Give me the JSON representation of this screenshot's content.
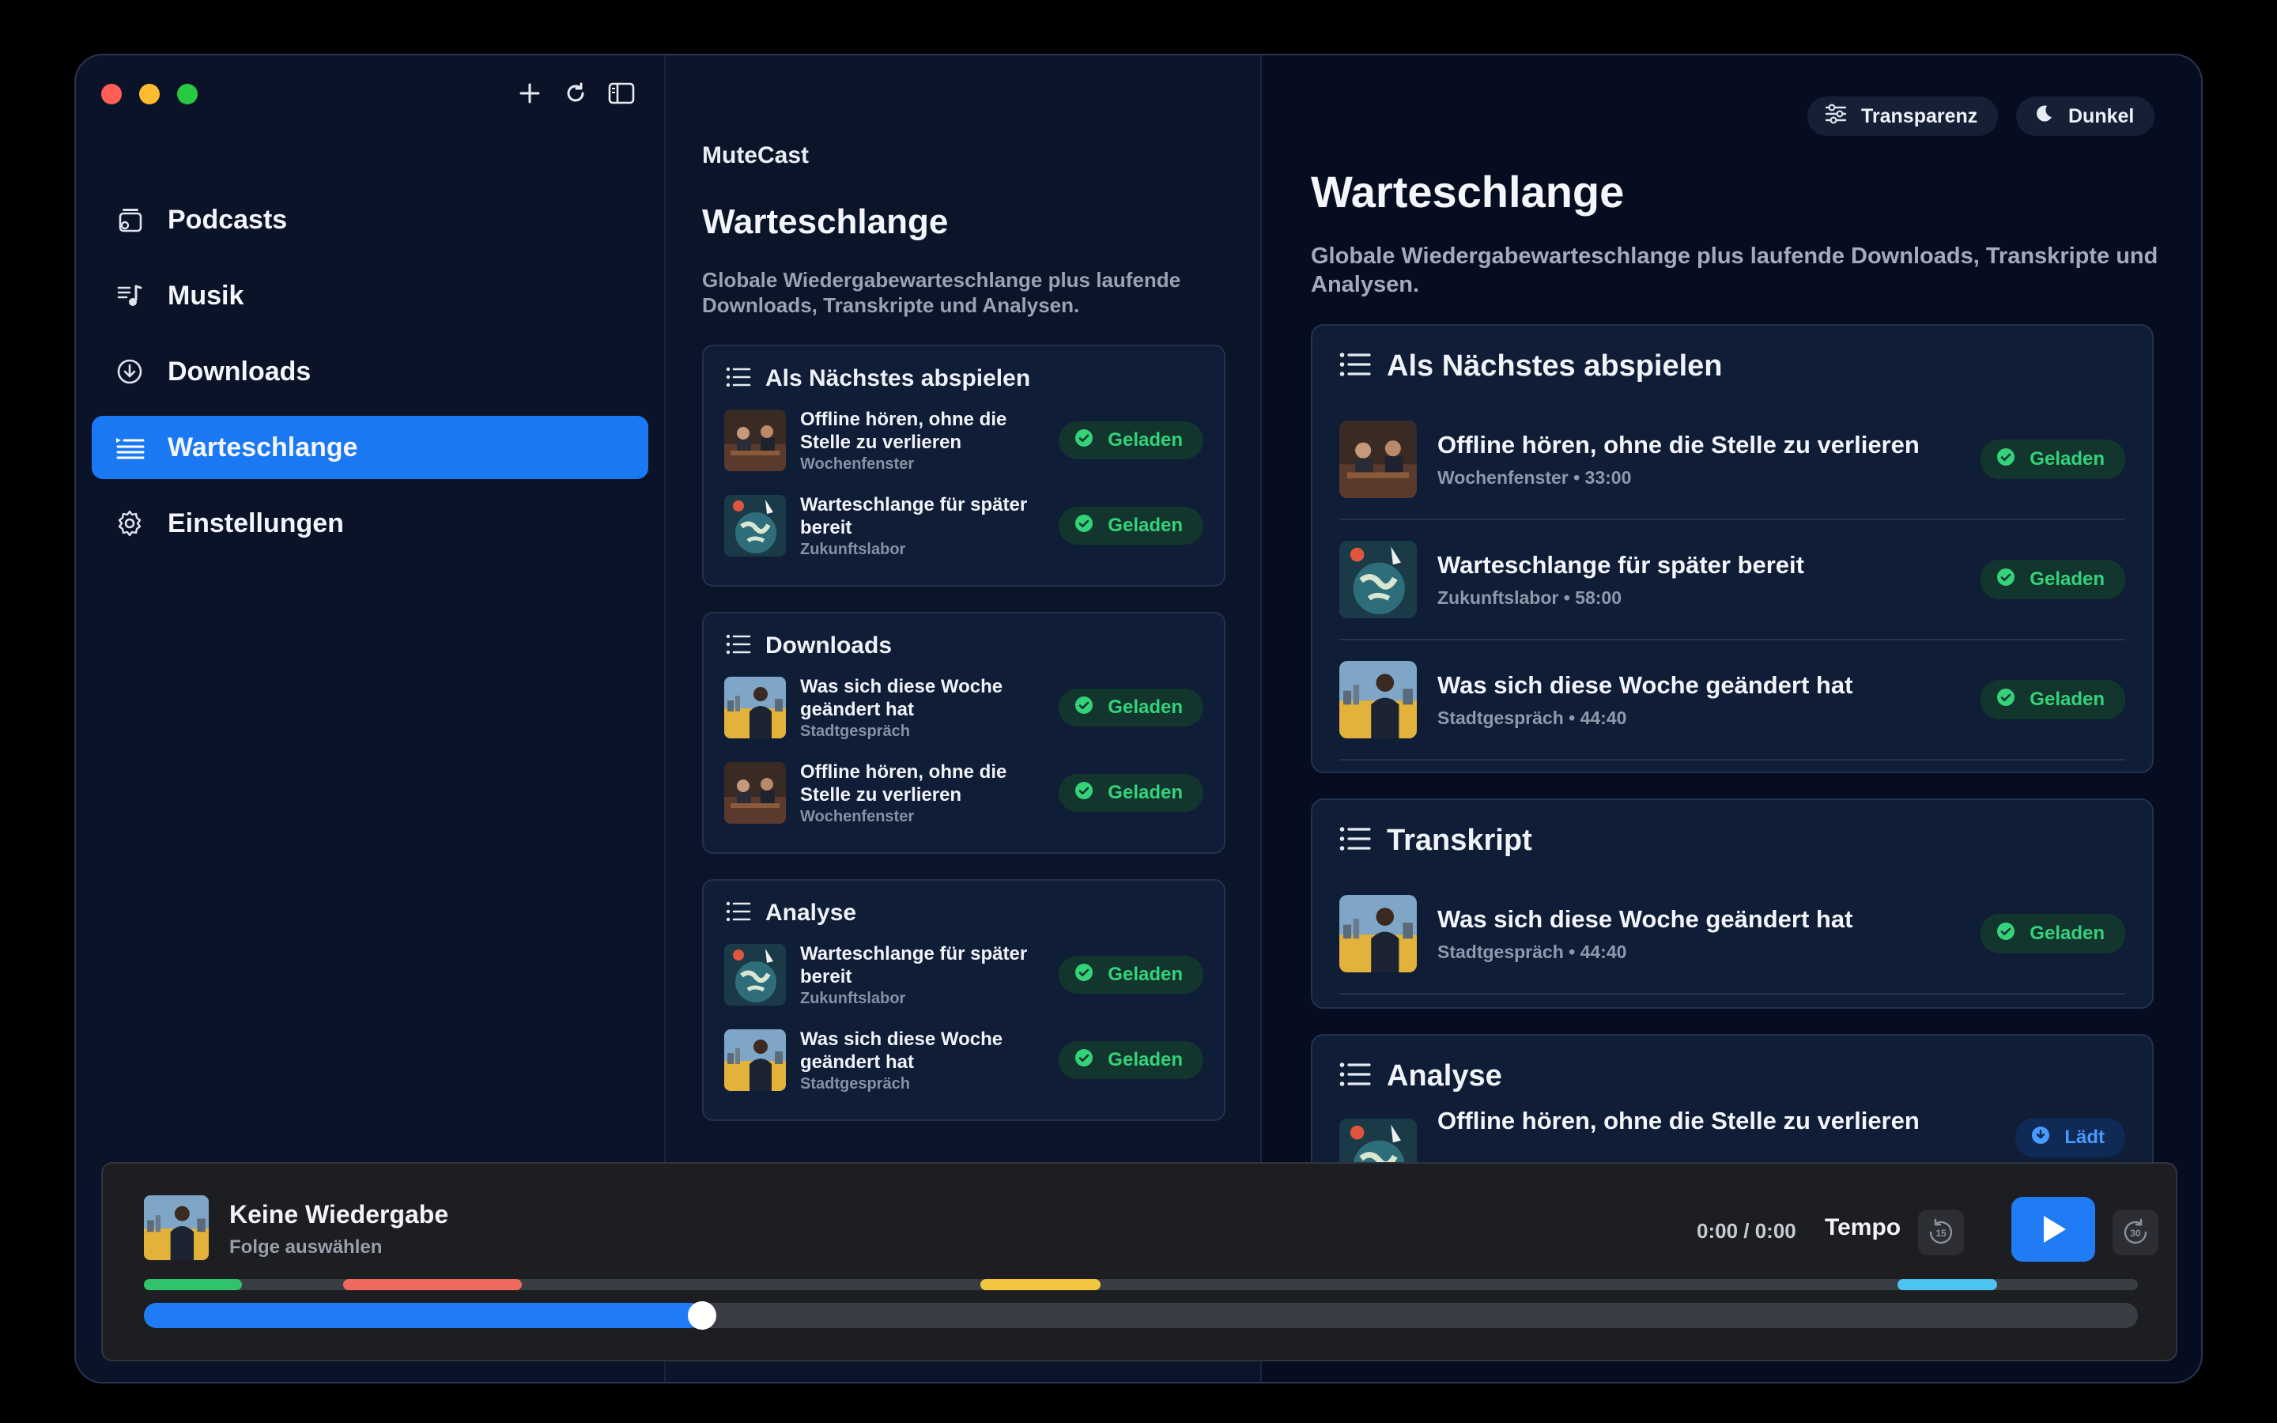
{
  "app": {
    "name": "MuteCast"
  },
  "sidebar": {
    "items": [
      {
        "label": "Podcasts",
        "icon": "podcasts-icon",
        "active": false
      },
      {
        "label": "Musik",
        "icon": "music-icon",
        "active": false
      },
      {
        "label": "Downloads",
        "icon": "download-icon",
        "active": false
      },
      {
        "label": "Warteschlange",
        "icon": "queue-icon",
        "active": true
      },
      {
        "label": "Einstellungen",
        "icon": "gear-icon",
        "active": false
      }
    ]
  },
  "middle": {
    "title": "Warteschlange",
    "subtitle": "Globale Wiedergabewarteschlange plus laufende Downloads, Transkripte und Analysen.",
    "sections": [
      {
        "title": "Als Nächstes abspielen",
        "items": [
          {
            "title": "Offline hören, ohne die Stelle zu verlieren",
            "show": "Wochenfenster",
            "status": "Geladen"
          },
          {
            "title": "Warteschlange für später bereit",
            "show": "Zukunftslabor",
            "status": "Geladen"
          }
        ]
      },
      {
        "title": "Downloads",
        "items": [
          {
            "title": "Was sich diese Woche geändert hat",
            "show": "Stadtgespräch",
            "status": "Geladen"
          },
          {
            "title": "Offline hören, ohne die Stelle zu verlieren",
            "show": "Wochenfenster",
            "status": "Geladen"
          }
        ]
      },
      {
        "title": "Analyse",
        "items": [
          {
            "title": "Warteschlange für später bereit",
            "show": "Zukunftslabor",
            "status": "Geladen"
          },
          {
            "title": "Was sich diese Woche geändert hat",
            "show": "Stadtgespräch",
            "status": "Geladen"
          }
        ]
      }
    ]
  },
  "right": {
    "toolbar": {
      "transparency_label": "Transparenz",
      "theme_label": "Dunkel"
    },
    "title": "Warteschlange",
    "subtitle": "Globale Wiedergabewarteschlange plus laufende Downloads, Transkripte und Analysen.",
    "sections": [
      {
        "title": "Als Nächstes abspielen",
        "items": [
          {
            "title": "Offline hören, ohne die Stelle zu verlieren",
            "meta": "Wochenfenster • 33:00",
            "status": "Geladen"
          },
          {
            "title": "Warteschlange für später bereit",
            "meta": "Zukunftslabor • 58:00",
            "status": "Geladen"
          },
          {
            "title": "Was sich diese Woche geändert hat",
            "meta": "Stadtgespräch • 44:40",
            "status": "Geladen"
          }
        ]
      },
      {
        "title": "Transkript",
        "items": [
          {
            "title": "Was sich diese Woche geändert hat",
            "meta": "Stadtgespräch • 44:40",
            "status": "Geladen"
          }
        ]
      },
      {
        "title": "Analyse",
        "items": [
          {
            "title": "Offline hören, ohne die Stelle zu verlieren",
            "meta": "",
            "status": "Lädt"
          }
        ]
      }
    ]
  },
  "player": {
    "title": "Keine Wiedergabe",
    "subtitle": "Folge auswählen",
    "time": "0:00 / 0:00",
    "tempo_label": "Tempo",
    "skip_back": "15",
    "skip_forward": "30",
    "progress": 0.28
  },
  "colors": {
    "accent": "#1f7cf5",
    "loaded": "#35d27a",
    "chapter_green": "#2fc46a",
    "chapter_red": "#ee6a5f",
    "chapter_yellow": "#f3c63f",
    "chapter_cyan": "#4cc4ef"
  }
}
